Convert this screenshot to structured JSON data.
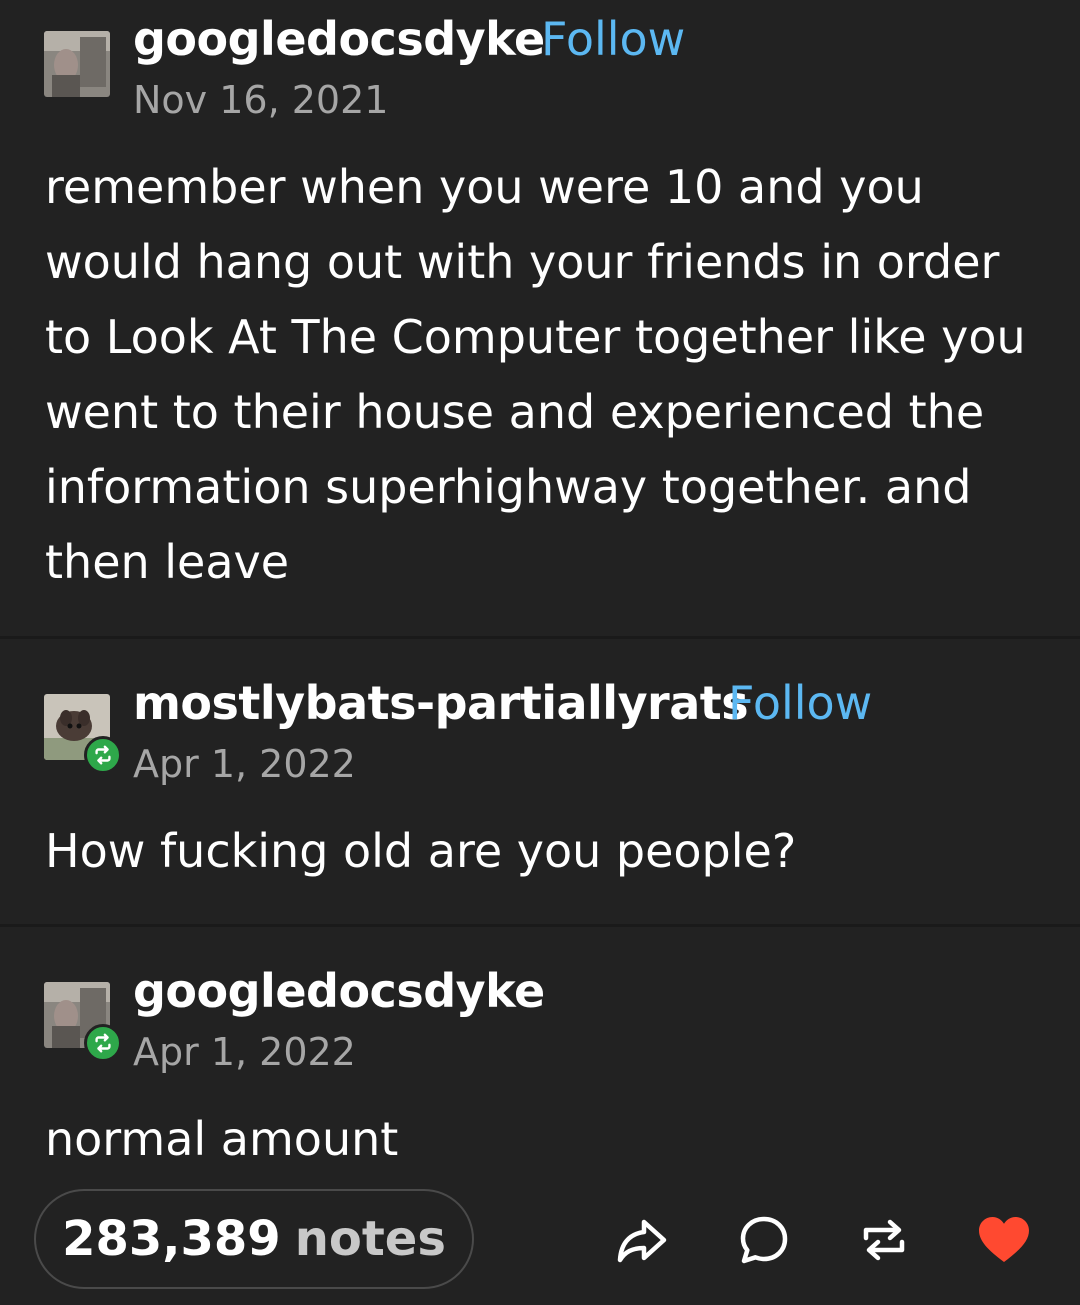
{
  "posts": [
    {
      "username": "googledocsdyke",
      "follow_label": "Follow",
      "date": "Nov 16, 2021",
      "text": "remember when you were 10 and you would hang out with your friends in order to Look At The Computer together like you went to their house and experienced the information superhighway together. and then leave"
    },
    {
      "username": "mostlybats-partiallyrats",
      "follow_label": "Follow",
      "date": "Apr 1, 2022",
      "text": "How fucking old are you people?"
    },
    {
      "username": "googledocsdyke",
      "date": "Apr 1, 2022",
      "text": "normal amount"
    }
  ],
  "footer": {
    "notes_count": "283,389",
    "notes_label": "notes"
  },
  "icons": {
    "share": "share-icon",
    "reply": "reply-icon",
    "reblog": "reblog-icon",
    "like": "heart-icon",
    "reblog_badge": "reblog-badge-icon"
  },
  "colors": {
    "background": "#222222",
    "follow": "#5cb8f2",
    "reblog_green": "#2ea84a",
    "like_red": "#ff4930",
    "date_gray": "#a6a6a6"
  }
}
